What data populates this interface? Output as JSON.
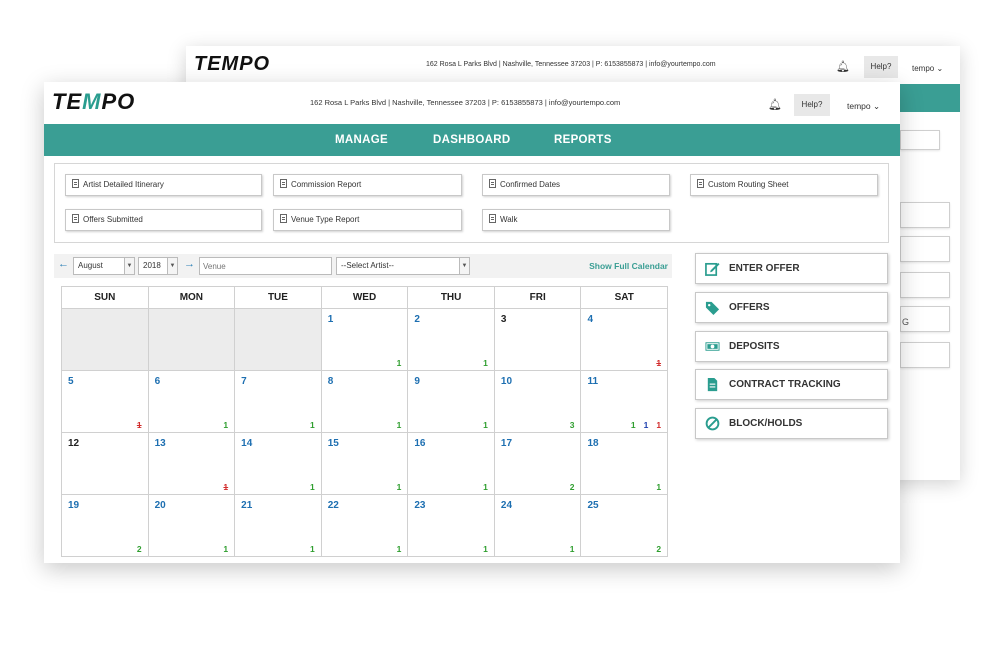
{
  "back_window": {
    "logo": "TEMPO",
    "address": "162 Rosa L Parks Blvd | Nashville, Tennessee 37203 | P: 6153855873 | info@yourtempo.com",
    "help_label": "Help?",
    "user_label": "tempo",
    "partial_text": "G"
  },
  "header": {
    "logo": {
      "t": "TE",
      "m": "M",
      "p": "PO"
    },
    "address": "162 Rosa L Parks Blvd | Nashville, Tennessee 37203 | P: 6153855873 | info@yourtempo.com",
    "help_label": "Help?",
    "user_label": "tempo"
  },
  "nav": {
    "manage": "MANAGE",
    "dashboard": "DASHBOARD",
    "reports": "REPORTS"
  },
  "reports": [
    "Artist Detailed Itinerary",
    "Commission Report",
    "Confirmed Dates",
    "Custom Routing Sheet",
    "Offers Submitted",
    "Venue Type Report",
    "Walk"
  ],
  "calendar_toolbar": {
    "month": "August",
    "year": "2018",
    "venue_placeholder": "Venue",
    "artist_select": "--Select Artist--",
    "show_full": "Show Full Calendar"
  },
  "calendar": {
    "days": [
      "SUN",
      "MON",
      "TUE",
      "WED",
      "THU",
      "FRI",
      "SAT"
    ],
    "weeks": [
      [
        {
          "day": "",
          "badges": []
        },
        {
          "day": "",
          "badges": []
        },
        {
          "day": "",
          "badges": []
        },
        {
          "day": "1",
          "badges": [
            {
              "v": "1",
              "c": "green"
            }
          ]
        },
        {
          "day": "2",
          "badges": [
            {
              "v": "1",
              "c": "green"
            }
          ]
        },
        {
          "day": "3",
          "dark": true,
          "badges": []
        },
        {
          "day": "4",
          "badges": [
            {
              "v": "1",
              "c": "strike"
            }
          ]
        }
      ],
      [
        {
          "day": "5",
          "badges": [
            {
              "v": "1",
              "c": "strike"
            }
          ]
        },
        {
          "day": "6",
          "badges": [
            {
              "v": "1",
              "c": "green"
            }
          ]
        },
        {
          "day": "7",
          "badges": [
            {
              "v": "1",
              "c": "green"
            }
          ]
        },
        {
          "day": "8",
          "badges": [
            {
              "v": "1",
              "c": "green"
            }
          ]
        },
        {
          "day": "9",
          "badges": [
            {
              "v": "1",
              "c": "green"
            }
          ]
        },
        {
          "day": "10",
          "badges": [
            {
              "v": "3",
              "c": "green"
            }
          ]
        },
        {
          "day": "11",
          "badges": [
            {
              "v": "1",
              "c": "green"
            },
            {
              "v": "1",
              "c": "blue"
            },
            {
              "v": "1",
              "c": "red"
            }
          ]
        }
      ],
      [
        {
          "day": "12",
          "dark": true,
          "badges": []
        },
        {
          "day": "13",
          "badges": [
            {
              "v": "1",
              "c": "strike"
            }
          ]
        },
        {
          "day": "14",
          "badges": [
            {
              "v": "1",
              "c": "green"
            }
          ]
        },
        {
          "day": "15",
          "badges": [
            {
              "v": "1",
              "c": "green"
            }
          ]
        },
        {
          "day": "16",
          "badges": [
            {
              "v": "1",
              "c": "green"
            }
          ]
        },
        {
          "day": "17",
          "badges": [
            {
              "v": "2",
              "c": "green"
            }
          ]
        },
        {
          "day": "18",
          "badges": [
            {
              "v": "1",
              "c": "green"
            }
          ]
        }
      ],
      [
        {
          "day": "19",
          "badges": [
            {
              "v": "2",
              "c": "green"
            }
          ]
        },
        {
          "day": "20",
          "badges": [
            {
              "v": "1",
              "c": "green"
            }
          ]
        },
        {
          "day": "21",
          "badges": [
            {
              "v": "1",
              "c": "green"
            }
          ]
        },
        {
          "day": "22",
          "badges": [
            {
              "v": "1",
              "c": "green"
            }
          ]
        },
        {
          "day": "23",
          "badges": [
            {
              "v": "1",
              "c": "green"
            }
          ]
        },
        {
          "day": "24",
          "badges": [
            {
              "v": "1",
              "c": "green"
            }
          ]
        },
        {
          "day": "25",
          "badges": [
            {
              "v": "2",
              "c": "green"
            }
          ]
        }
      ]
    ]
  },
  "actions": [
    {
      "label": "ENTER OFFER",
      "icon": "edit-icon"
    },
    {
      "label": "OFFERS",
      "icon": "tag-icon"
    },
    {
      "label": "DEPOSITS",
      "icon": "money-icon"
    },
    {
      "label": "CONTRACT TRACKING",
      "icon": "document-icon"
    },
    {
      "label": "BLOCK/HOLDS",
      "icon": "block-icon"
    }
  ],
  "colors": {
    "teal": "#3a9e94",
    "day_blue": "#1d6fb1",
    "badge_green": "#2f9e2f",
    "badge_red": "#d22b2b",
    "badge_blue": "#1d3fae"
  }
}
